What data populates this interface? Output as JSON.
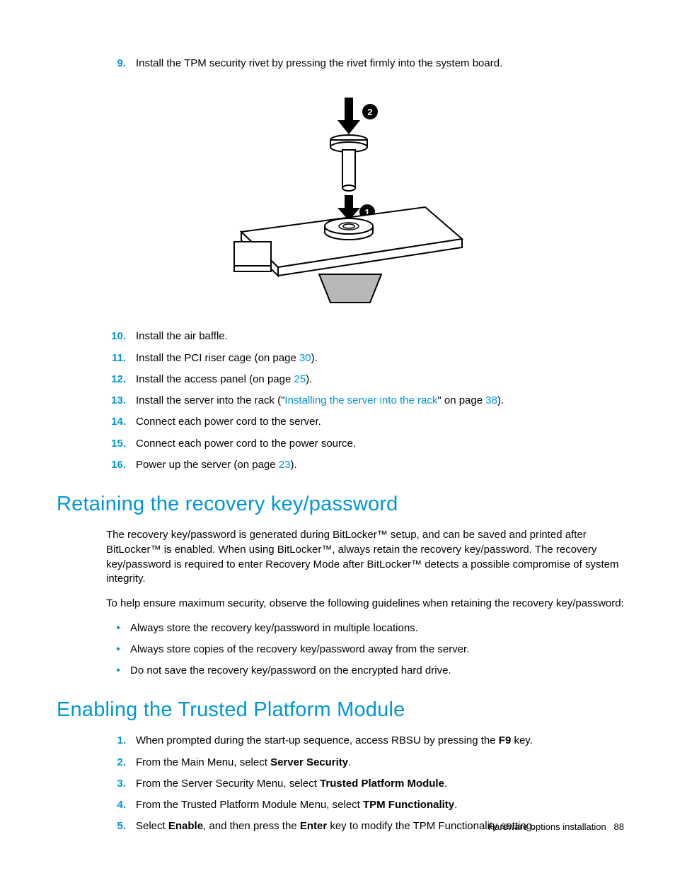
{
  "steps_a": [
    {
      "n": "9.",
      "pre": "Install the TPM security rivet by pressing the rivet firmly into the system board.",
      "link": null,
      "post": null
    },
    {
      "n": "10.",
      "pre": "Install the air baffle.",
      "link": null,
      "post": null
    },
    {
      "n": "11.",
      "pre": "Install the PCI riser cage (on page ",
      "link": "30",
      "post": ")."
    },
    {
      "n": "12.",
      "pre": "Install the access panel (on page ",
      "link": "25",
      "post": ")."
    },
    {
      "n": "13.",
      "pre": "Install the server into the rack (\"",
      "link": "Installing the server into the rack",
      "post": "\" on page ",
      "link2": "38",
      "post2": ")."
    },
    {
      "n": "14.",
      "pre": "Connect each power cord to the server.",
      "link": null,
      "post": null
    },
    {
      "n": "15.",
      "pre": "Connect each power cord to the power source.",
      "link": null,
      "post": null
    },
    {
      "n": "16.",
      "pre": "Power up the server (on page ",
      "link": "23",
      "post": ")."
    }
  ],
  "heading1": "Retaining the recovery key/password",
  "para1": "The recovery key/password is generated during BitLocker™ setup, and can be saved and printed after BitLocker™ is enabled. When using BitLocker™, always retain the recovery key/password. The recovery key/password is required to enter Recovery Mode after BitLocker™ detects a possible compromise of system integrity.",
  "para2": "To help ensure maximum security, observe the following guidelines when retaining the recovery key/password:",
  "bullets": [
    "Always store the recovery key/password in multiple locations.",
    "Always store copies of the recovery key/password away from the server.",
    "Do not save the recovery key/password on the encrypted hard drive."
  ],
  "heading2": "Enabling the Trusted Platform Module",
  "steps_b": [
    {
      "n": "1.",
      "segs": [
        {
          "t": "When prompted during the start-up sequence, access RBSU by pressing the "
        },
        {
          "t": "F9",
          "b": true
        },
        {
          "t": " key."
        }
      ]
    },
    {
      "n": "2.",
      "segs": [
        {
          "t": "From the Main Menu, select "
        },
        {
          "t": "Server Security",
          "b": true
        },
        {
          "t": "."
        }
      ]
    },
    {
      "n": "3.",
      "segs": [
        {
          "t": "From the Server Security Menu, select "
        },
        {
          "t": "Trusted Platform Module",
          "b": true
        },
        {
          "t": "."
        }
      ]
    },
    {
      "n": "4.",
      "segs": [
        {
          "t": "From the Trusted Platform Module Menu, select "
        },
        {
          "t": "TPM Functionality",
          "b": true
        },
        {
          "t": "."
        }
      ]
    },
    {
      "n": "5.",
      "segs": [
        {
          "t": "Select "
        },
        {
          "t": "Enable",
          "b": true
        },
        {
          "t": ", and then press the "
        },
        {
          "t": "Enter",
          "b": true
        },
        {
          "t": " key to modify the TPM Functionality setting."
        }
      ]
    }
  ],
  "footer_section": "Hardware options installation",
  "footer_page": "88"
}
